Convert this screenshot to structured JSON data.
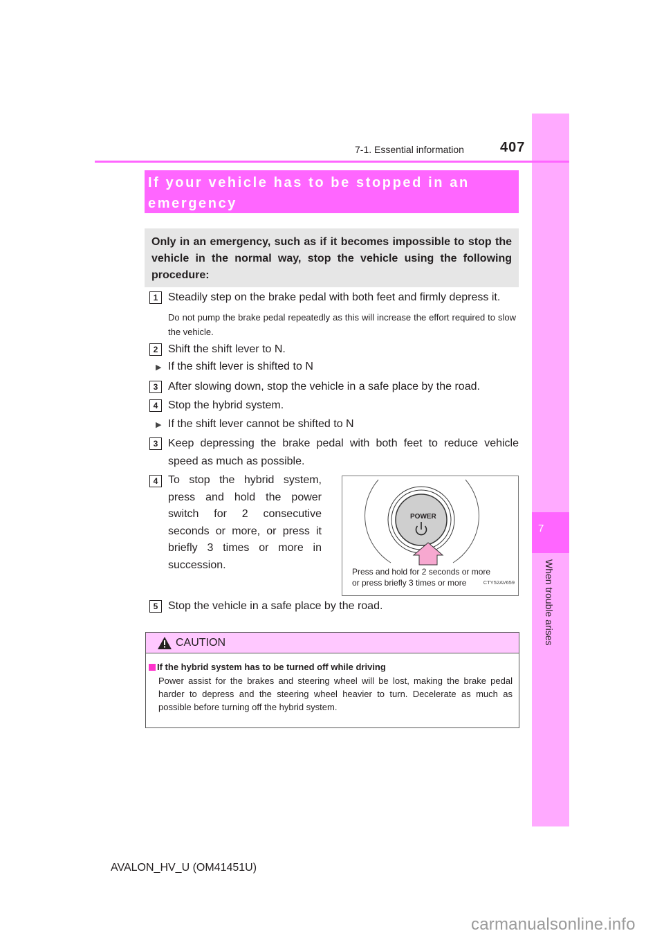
{
  "header": {
    "section": "7-1. Essential information",
    "page_number": "407"
  },
  "side_tab": {
    "chapter_number": "7",
    "chapter_title": "When trouble arises",
    "color": "#ffaaff",
    "accent": "#ff66ff"
  },
  "title": "If your vehicle has to be stopped in an emergency",
  "intro": "Only in an emergency, such as if it becomes impossible to stop the vehicle in the normal way, stop the vehicle using the following procedure:",
  "steps": {
    "s1": {
      "num": "1",
      "text": "Steadily step on the brake pedal with both feet and firmly depress it.",
      "note": "Do not pump the brake pedal repeatedly as this will increase the effort required to slow the vehicle."
    },
    "s2": {
      "num": "2",
      "text": "Shift the shift lever to N."
    },
    "case_a": "If the shift lever is shifted to N",
    "s3a": {
      "num": "3",
      "text": "After slowing down, stop the vehicle in a safe place by the road."
    },
    "s4a": {
      "num": "4",
      "text": "Stop the hybrid system."
    },
    "case_b": "If the shift lever cannot be shifted to N",
    "s3b": {
      "num": "3",
      "text": "Keep depressing the brake pedal with both feet to reduce vehicle speed as much as possible."
    },
    "s4b": {
      "num": "4",
      "text": "To stop the hybrid system, press and hold the power switch for 2 consecutive seconds or more, or press it briefly 3 times or more in succession."
    },
    "s5": {
      "num": "5",
      "text": "Stop the vehicle in a safe place by the road."
    }
  },
  "figure": {
    "button_label": "POWER",
    "icon": "power-icon",
    "caption_line1": "Press and hold for 2 seconds or more",
    "caption_line2": "or press briefly 3 times or more",
    "code": "CTY52AV659"
  },
  "caution": {
    "label": "CAUTION",
    "heading": "If the hybrid system has to be turned off while driving",
    "body": "Power assist for the brakes and steering wheel will be lost, making the brake pedal harder to depress and the steering wheel heavier to turn. Decelerate as much as possible before turning off the hybrid system."
  },
  "footer": "AVALON_HV_U (OM41451U)",
  "watermark": "carmanualsonline.info"
}
